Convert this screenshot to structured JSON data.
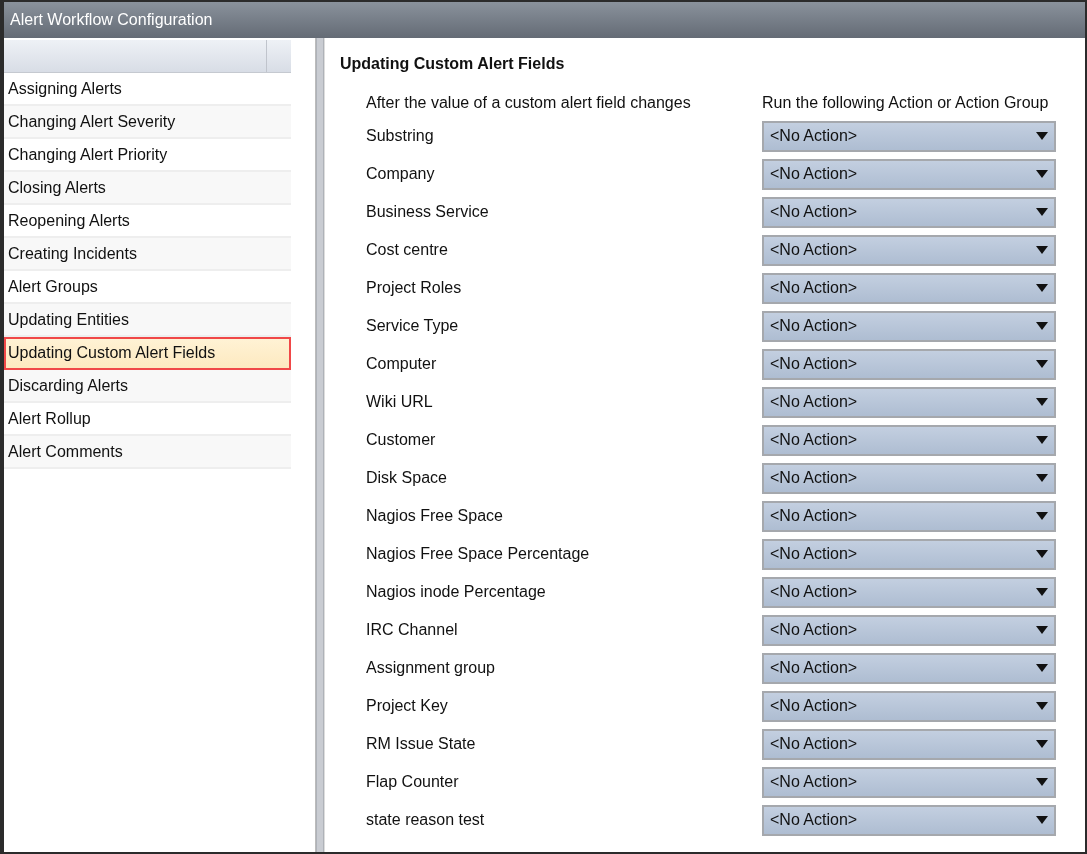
{
  "window": {
    "title": "Alert Workflow Configuration"
  },
  "sidebar": {
    "items": [
      {
        "label": "Assigning Alerts",
        "selected": false
      },
      {
        "label": "Changing Alert Severity",
        "selected": false
      },
      {
        "label": "Changing Alert Priority",
        "selected": false
      },
      {
        "label": "Closing Alerts",
        "selected": false
      },
      {
        "label": "Reopening Alerts",
        "selected": false
      },
      {
        "label": "Creating Incidents",
        "selected": false
      },
      {
        "label": "Alert Groups",
        "selected": false
      },
      {
        "label": "Updating Entities",
        "selected": false
      },
      {
        "label": "Updating Custom Alert Fields",
        "selected": true
      },
      {
        "label": "Discarding Alerts",
        "selected": false
      },
      {
        "label": "Alert Rollup",
        "selected": false
      },
      {
        "label": "Alert Comments",
        "selected": false
      }
    ]
  },
  "content": {
    "heading": "Updating Custom Alert Fields",
    "columns": [
      "After the value of a custom alert field changes",
      "Run the following Action or Action Group"
    ],
    "rows": [
      {
        "field": "Substring",
        "action": "<No Action>"
      },
      {
        "field": "Company",
        "action": "<No Action>"
      },
      {
        "field": "Business Service",
        "action": "<No Action>"
      },
      {
        "field": "Cost centre",
        "action": "<No Action>"
      },
      {
        "field": "Project Roles",
        "action": "<No Action>"
      },
      {
        "field": "Service Type",
        "action": "<No Action>"
      },
      {
        "field": "Computer",
        "action": "<No Action>"
      },
      {
        "field": "Wiki URL",
        "action": "<No Action>"
      },
      {
        "field": "Customer",
        "action": "<No Action>"
      },
      {
        "field": "Disk Space",
        "action": "<No Action>"
      },
      {
        "field": "Nagios Free Space",
        "action": "<No Action>"
      },
      {
        "field": "Nagios Free Space Percentage",
        "action": "<No Action>"
      },
      {
        "field": "Nagios inode Percentage",
        "action": "<No Action>"
      },
      {
        "field": "IRC Channel",
        "action": "<No Action>"
      },
      {
        "field": "Assignment group",
        "action": "<No Action>"
      },
      {
        "field": "Project Key",
        "action": "<No Action>"
      },
      {
        "field": "RM Issue State",
        "action": "<No Action>"
      },
      {
        "field": "Flap Counter",
        "action": "<No Action>"
      },
      {
        "field": "state reason test",
        "action": "<No Action>"
      }
    ]
  }
}
